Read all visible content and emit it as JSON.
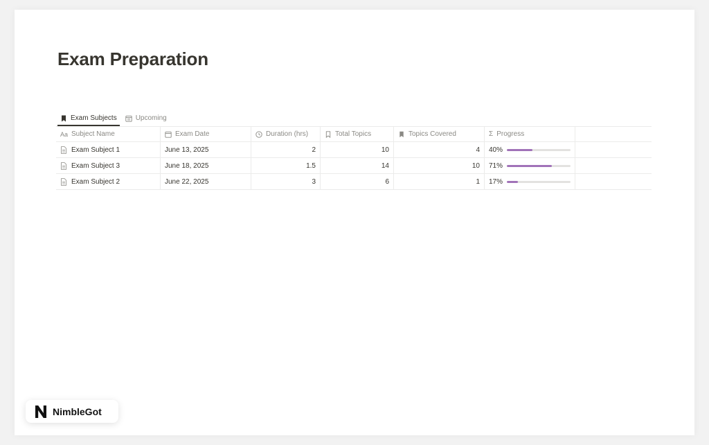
{
  "page": {
    "title": "Exam Preparation"
  },
  "tabs": [
    {
      "label": "Exam Subjects",
      "icon": "bookmark-icon",
      "active": true
    },
    {
      "label": "Upcoming",
      "icon": "calendar-icon",
      "active": false
    }
  ],
  "table": {
    "columns": [
      {
        "label": "Subject Name",
        "icon": "text-aa-icon"
      },
      {
        "label": "Exam Date",
        "icon": "calendar-icon"
      },
      {
        "label": "Duration (hrs)",
        "icon": "clock-icon"
      },
      {
        "label": "Total Topics",
        "icon": "bookmark-outline-icon"
      },
      {
        "label": "Topics Covered",
        "icon": "bookmark-icon"
      },
      {
        "label": "Progress",
        "icon": "sigma-icon"
      }
    ],
    "rows": [
      {
        "name": "Exam Subject 1",
        "date": "June 13, 2025",
        "duration": "2",
        "total": "10",
        "covered": "4",
        "progress_label": "40%",
        "progress": 40
      },
      {
        "name": "Exam Subject 3",
        "date": "June 18, 2025",
        "duration": "1.5",
        "total": "14",
        "covered": "10",
        "progress_label": "71%",
        "progress": 71
      },
      {
        "name": "Exam Subject 2",
        "date": "June 22, 2025",
        "duration": "3",
        "total": "6",
        "covered": "1",
        "progress_label": "17%",
        "progress": 17
      }
    ]
  },
  "colors": {
    "progress_fill": "#a172b8",
    "progress_track": "#e3e2e0"
  },
  "brand": {
    "name": "NimbleGot",
    "icon": "nimblegot-logo-icon"
  }
}
